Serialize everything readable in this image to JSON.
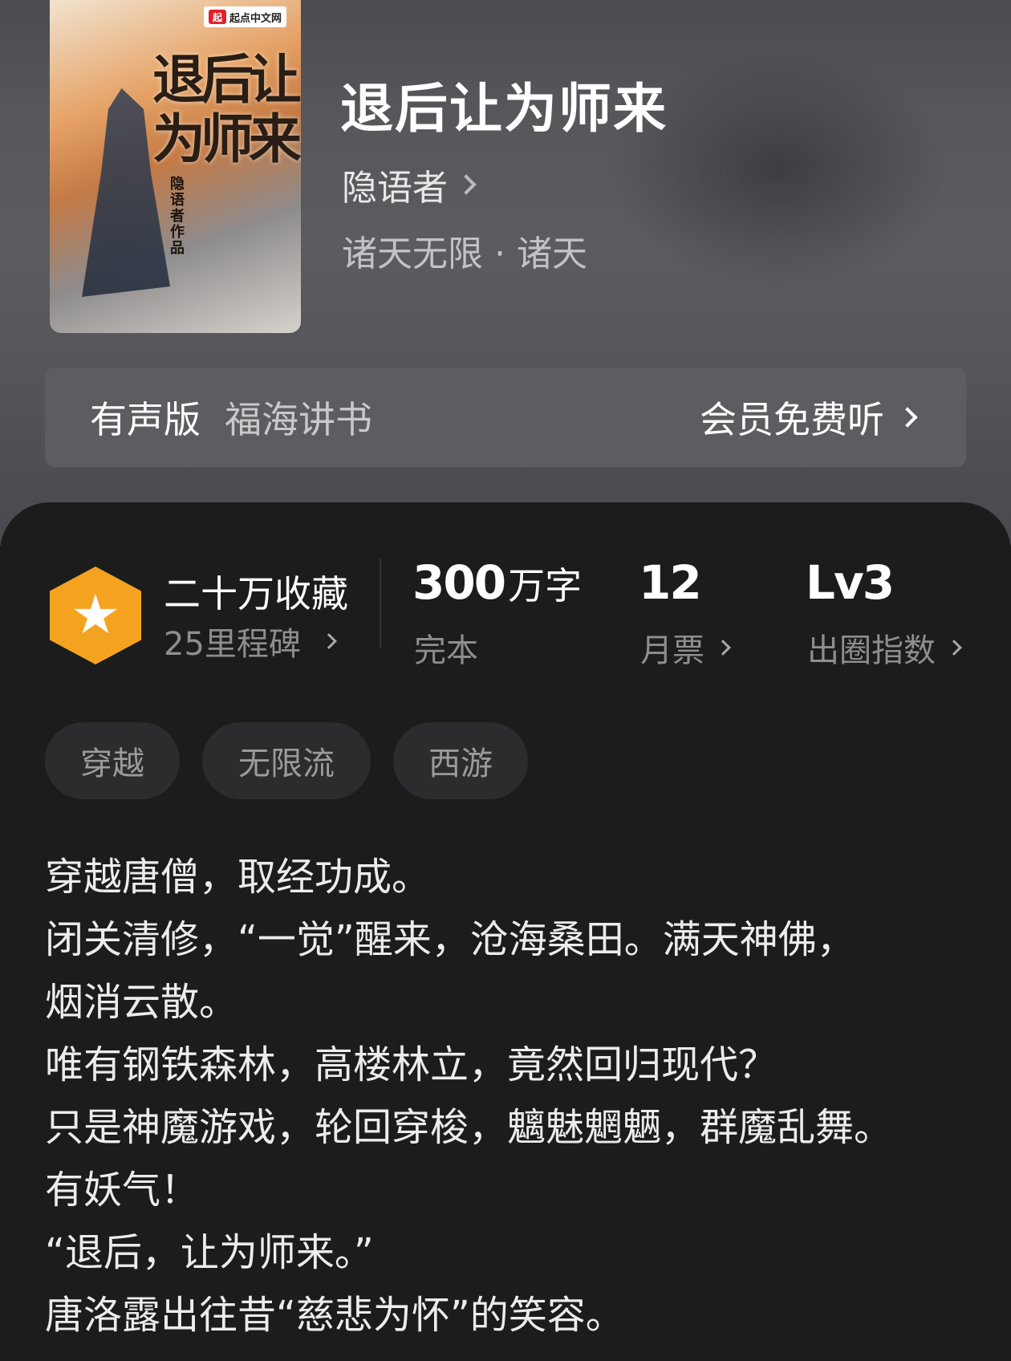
{
  "book": {
    "title": "退后让为师来",
    "author": "隐语者",
    "genre": "诸天无限 · 诸天"
  },
  "cover": {
    "publisher_logo": "起点中文网",
    "publisher_mark": "起",
    "title_art": "退后让为师来",
    "author_credit": "隐语者作品"
  },
  "audio": {
    "label": "有声版",
    "narrator": "福海讲书",
    "action": "会员免费听"
  },
  "stats": {
    "collection": {
      "title": "二十万收藏",
      "sub": "25里程碑"
    },
    "words": {
      "number": "300",
      "unit": "万字",
      "sub": "完本"
    },
    "votes": {
      "number": "12",
      "sub": "月票"
    },
    "level": {
      "number": "Lv3",
      "sub": "出圈指数"
    }
  },
  "tags": [
    "穿越",
    "无限流",
    "西游"
  ],
  "description": [
    "穿越唐僧，取经功成。",
    "闭关清修，“一觉”醒来，沧海桑田。满天神佛，",
    "烟消云散。",
    "唯有钢铁森林，高楼林立，竟然回归现代？",
    "只是神魔游戏，轮回穿梭，魑魅魍魉，群魔乱舞。",
    "有妖气！",
    "“退后，让为师来。”",
    "唐洛露出往昔“慈悲为怀”的笑容。"
  ],
  "colors": {
    "badge": "#f4a321",
    "panel": "#1c1c1d",
    "hero": "#55575b"
  },
  "icons": {
    "badge": "star-icon",
    "chevron": "chevron-right-icon"
  }
}
